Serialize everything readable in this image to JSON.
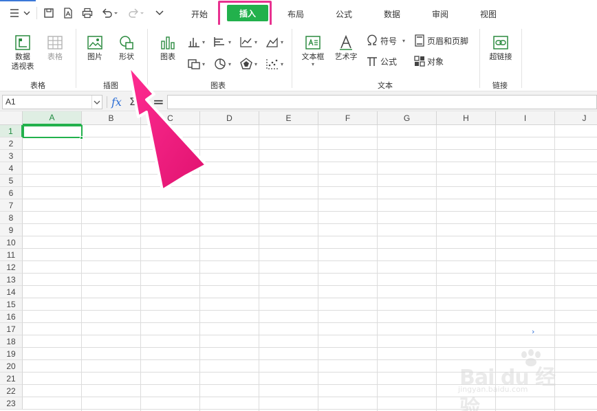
{
  "quick_access": {
    "menu_icon": "hamburger-icon",
    "items": [
      "save-icon",
      "pdf-export-icon",
      "print-icon",
      "undo-icon",
      "redo-icon",
      "more-icon"
    ]
  },
  "tabs": [
    {
      "label": "开始"
    },
    {
      "label": "插入",
      "active": true
    },
    {
      "label": "布局"
    },
    {
      "label": "公式"
    },
    {
      "label": "数据"
    },
    {
      "label": "审阅"
    },
    {
      "label": "视图"
    }
  ],
  "ribbon": {
    "table_group": {
      "name": "表格",
      "pivot_label_1": "数据",
      "pivot_label_2": "透视表",
      "table_label": "表格"
    },
    "illustrations_group": {
      "name": "插图",
      "picture_label": "图片",
      "shape_label": "形状"
    },
    "charts_group": {
      "name": "图表",
      "chart_label": "图表"
    },
    "text_group": {
      "name": "文本",
      "textbox_label": "文本框",
      "wordart_label": "艺术字",
      "symbol_label": "符号",
      "equation_label": "公式",
      "header_footer_label": "页眉和页脚",
      "object_label": "对象"
    },
    "links_group": {
      "name": "链接",
      "hyperlink_label": "超链接"
    }
  },
  "formula_bar": {
    "cell_ref": "A1",
    "fx_label": "fx",
    "sigma_label": "Σ",
    "equals_label": "=",
    "formula": ""
  },
  "sheet": {
    "columns": [
      "A",
      "B",
      "C",
      "D",
      "E",
      "F",
      "G",
      "H",
      "I",
      "J"
    ],
    "rows": [
      "1",
      "2",
      "3",
      "4",
      "5",
      "6",
      "7",
      "8",
      "9",
      "10",
      "11",
      "12",
      "13",
      "14",
      "15",
      "16",
      "17",
      "18",
      "19",
      "20",
      "21",
      "22",
      "23"
    ],
    "active_cell": "A1",
    "stray_mark": "›"
  },
  "annotation": {
    "highlight_color": "#e8318f",
    "arrow_color": "#f5197f"
  },
  "watermark": {
    "brand": "Bai du 经验",
    "url": "jingyan.baidu.com"
  },
  "colors": {
    "accent": "#22b14c",
    "formula_fx": "#2d6fd6"
  }
}
